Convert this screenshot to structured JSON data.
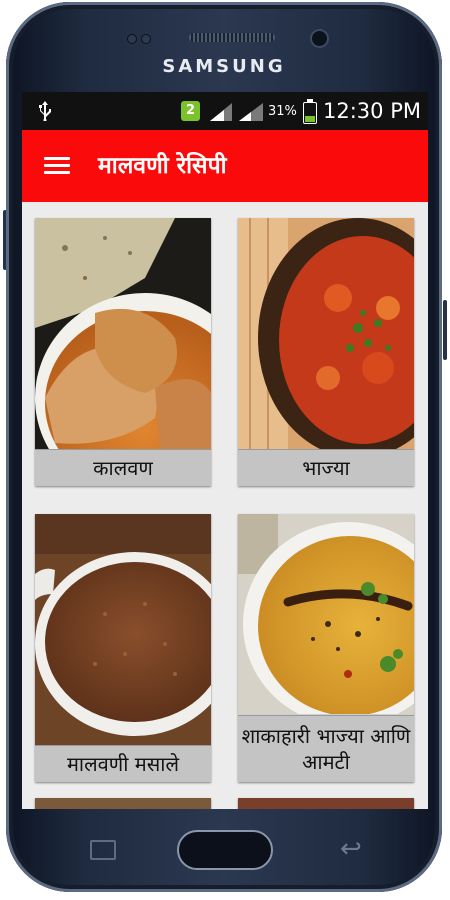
{
  "device": {
    "brand": "SAMSUNG"
  },
  "status_bar": {
    "usb_icon": "usb-icon",
    "sim_badge": "2",
    "battery_percent_text": "31%",
    "battery_level": 0.31,
    "time": "12:30 PM"
  },
  "app_bar": {
    "menu_icon": "hamburger-menu-icon",
    "title": "मालवणी रेसिपी",
    "color": "#fa0a0a"
  },
  "categories": [
    {
      "label": "कालवण"
    },
    {
      "label": "भाज्या"
    },
    {
      "label": "मालवणी मसाले"
    },
    {
      "label": "शाकाहारी भाज्या आणि आमटी"
    }
  ],
  "nav_icons": [
    "recent-apps-icon",
    "home-button",
    "back-icon"
  ]
}
